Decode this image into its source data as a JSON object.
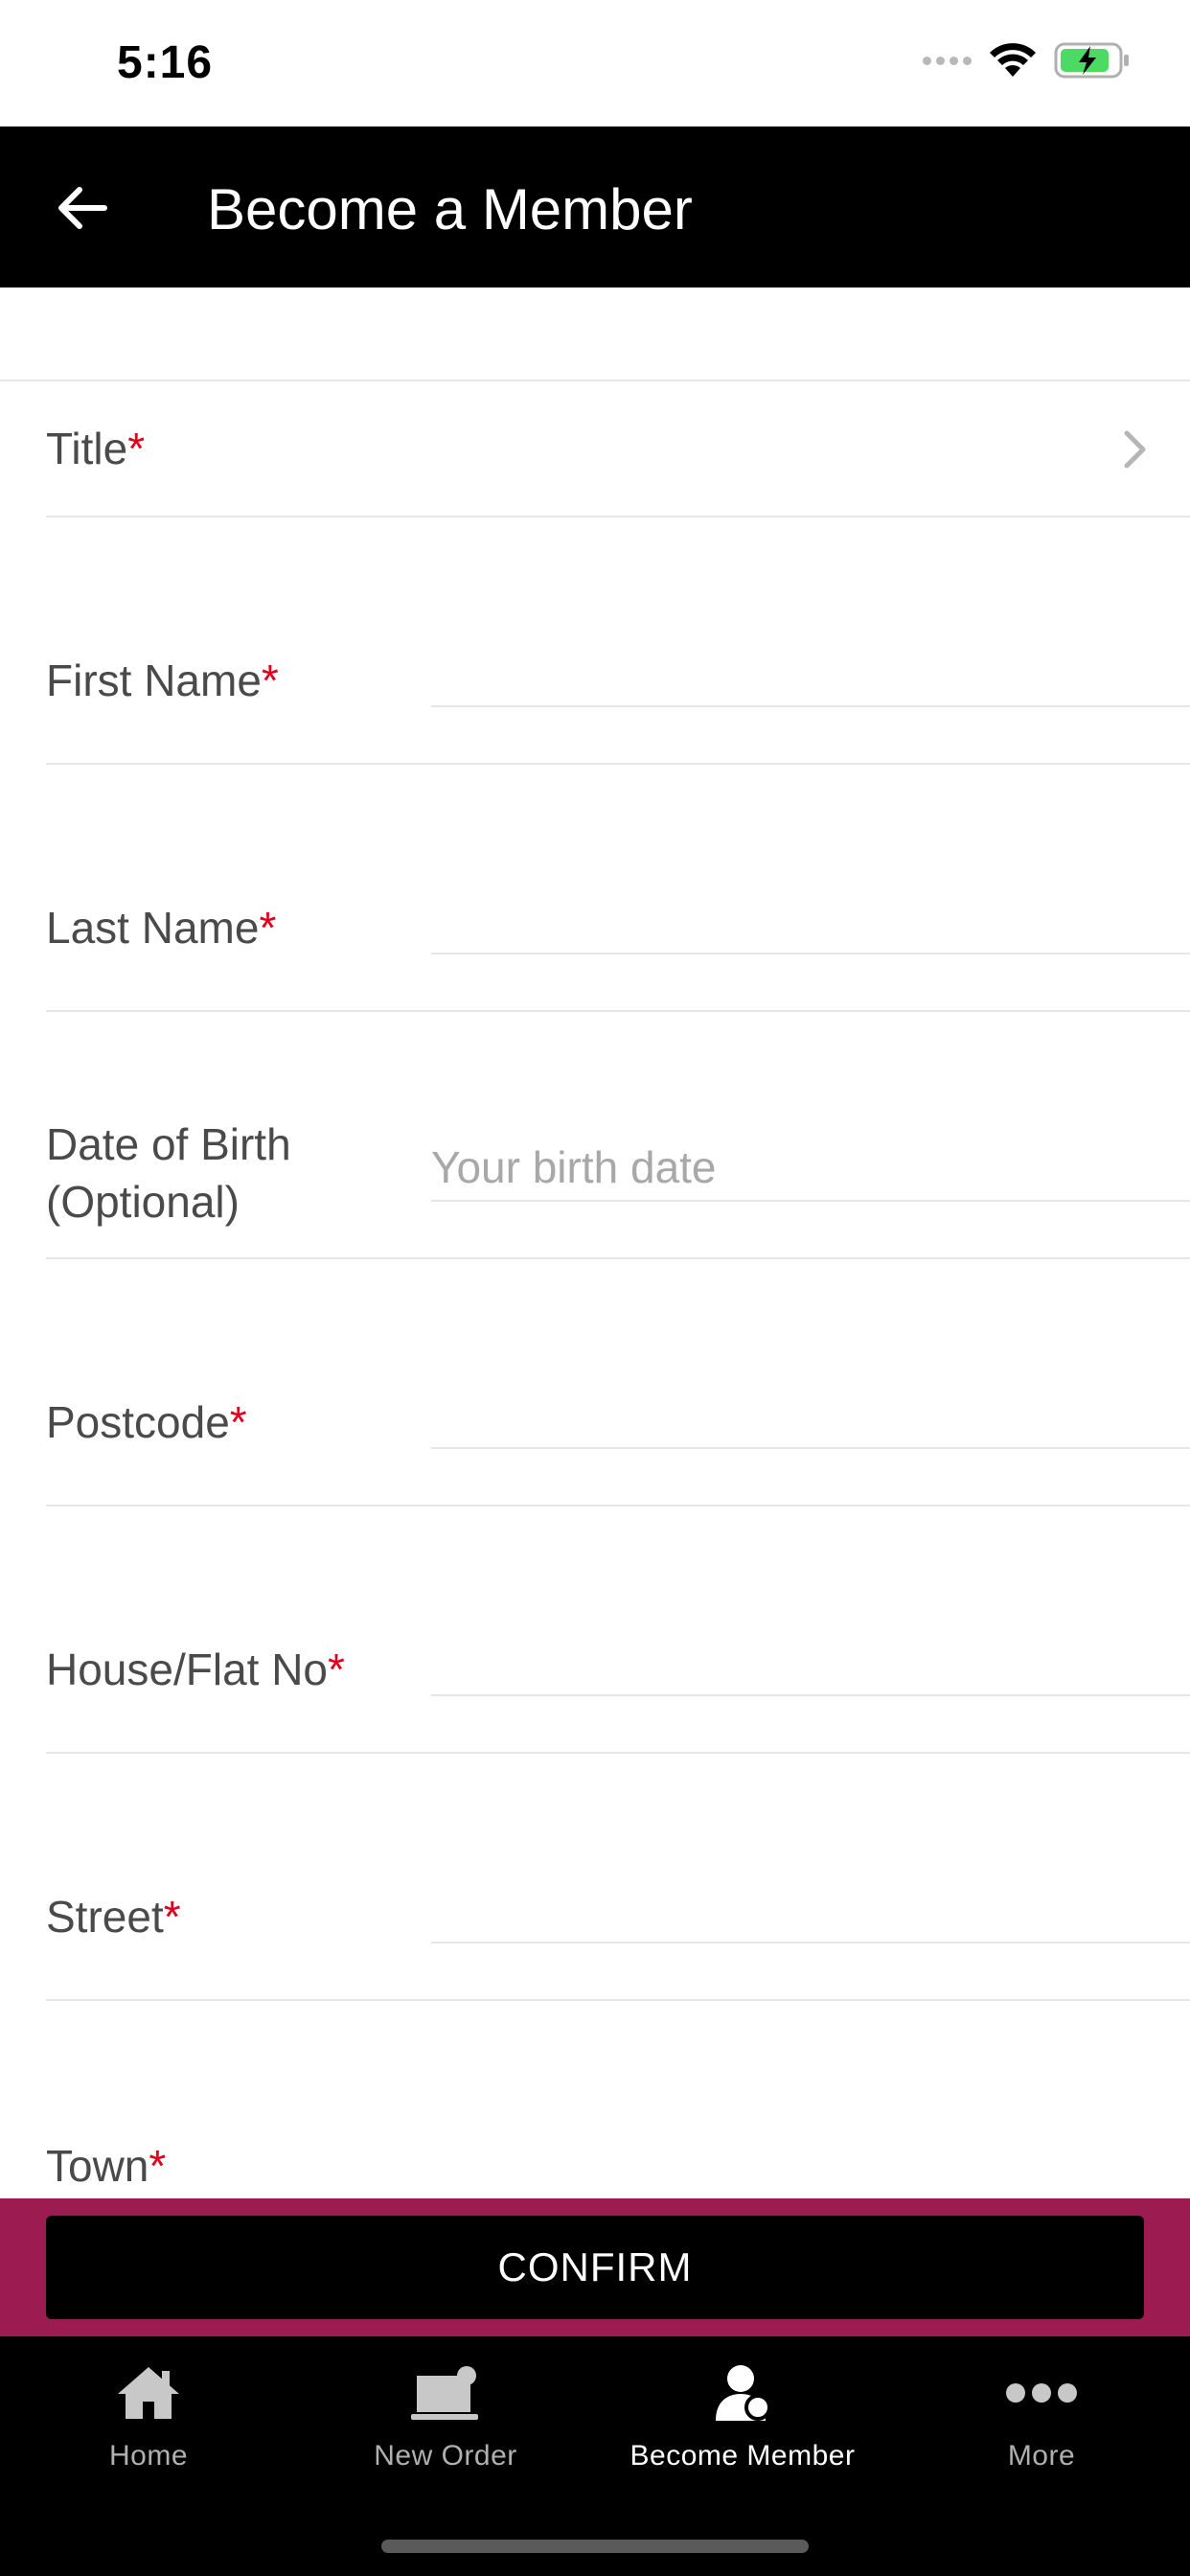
{
  "status_bar": {
    "time": "5:16"
  },
  "header": {
    "title": "Become a Member"
  },
  "form": {
    "title_label": "Title",
    "first_name_label": "First Name",
    "last_name_label": "Last Name",
    "dob_label_line1": "Date of Birth",
    "dob_label_line2": "(Optional)",
    "dob_placeholder": "Your birth date",
    "postcode_label": "Postcode",
    "house_label": "House/Flat No",
    "street_label": "Street",
    "town_label": "Town",
    "required_mark": "*"
  },
  "confirm_label": "CONFIRM",
  "tabs": [
    {
      "label": "Home",
      "icon": "home-icon"
    },
    {
      "label": "New Order",
      "icon": "new-order-icon"
    },
    {
      "label": "Become Member",
      "icon": "member-icon",
      "active": true
    },
    {
      "label": "More",
      "icon": "more-icon"
    }
  ],
  "colors": {
    "header_bg": "#000000",
    "accent": "#9c1b50",
    "required": "#e0001b",
    "battery": "#4cd964"
  }
}
